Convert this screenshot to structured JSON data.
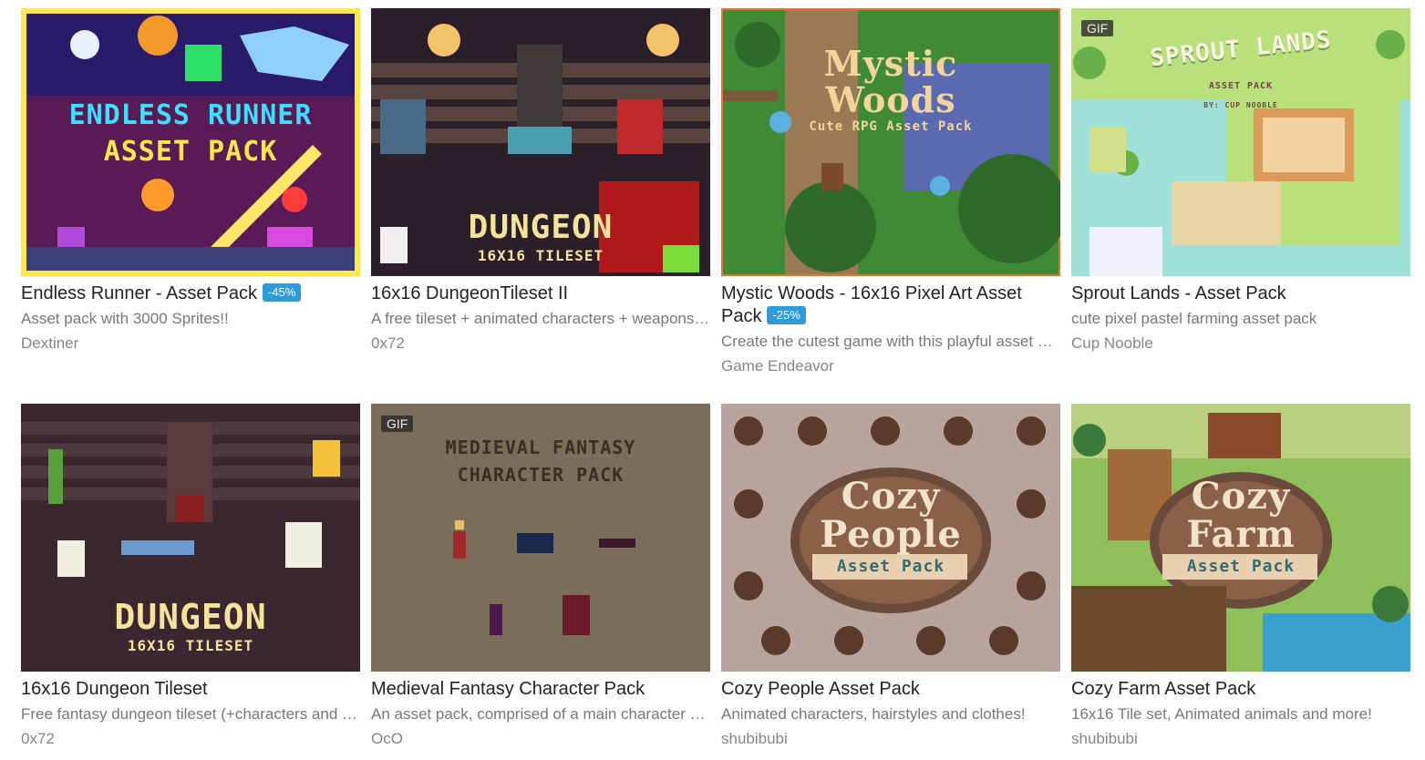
{
  "games": [
    {
      "title": "Endless Runner - Asset Pack",
      "sale": "-45%",
      "description": "Asset pack with 3000 Sprites!!",
      "author": "Dextiner",
      "gif": "",
      "art_line1": "ENDLESS RUNNER",
      "art_line2": "ASSET PACK"
    },
    {
      "title": "16x16 DungeonTileset II",
      "sale": "",
      "description": "A free tileset + animated characters + weapons…",
      "author": "0x72",
      "gif": "",
      "art_line1": "DUNGEON",
      "art_line2": "16X16 TILESET"
    },
    {
      "title": "Mystic Woods - 16x16 Pixel Art Asset Pack",
      "sale": "-25%",
      "description": "Create the cutest game with this playful asset p…",
      "author": "Game Endeavor",
      "gif": "",
      "art_line1": "Mystic",
      "art_line2": "Woods",
      "art_line3": "Cute RPG Asset Pack"
    },
    {
      "title": "Sprout Lands - Asset Pack",
      "sale": "",
      "description": "cute pixel pastel farming asset pack",
      "author": "Cup Nooble",
      "gif": "GIF",
      "art_line1": "SPROUT LANDS",
      "art_line2": "ASSET PACK",
      "art_line3": "BY: CUP NOOBLE"
    },
    {
      "title": "16x16 Dungeon Tileset",
      "sale": "",
      "description": "Free fantasy dungeon tileset (+characters and …",
      "author": "0x72",
      "gif": "",
      "art_line1": "DUNGEON",
      "art_line2": "16X16 TILESET"
    },
    {
      "title": "Medieval Fantasy Character Pack",
      "sale": "",
      "description": "An asset pack, comprised of a main character a…",
      "author": "OcO",
      "gif": "GIF",
      "art_line1": "MEDIEVAL FANTASY",
      "art_line2": "CHARACTER PACK"
    },
    {
      "title": "Cozy People Asset Pack",
      "sale": "",
      "description": "Animated characters, hairstyles and clothes!",
      "author": "shubibubi",
      "gif": "",
      "art_line1": "Cozy",
      "art_line2": "People",
      "art_line3": "Asset Pack"
    },
    {
      "title": "Cozy Farm Asset Pack",
      "sale": "",
      "description": "16x16 Tile set, Animated animals and more!",
      "author": "shubibubi",
      "gif": "",
      "art_line1": "Cozy",
      "art_line2": "Farm",
      "art_line3": "Asset Pack"
    }
  ],
  "colors": {
    "sale_badge": "#2d9cdb",
    "title": "#222222",
    "meta": "#777777"
  }
}
